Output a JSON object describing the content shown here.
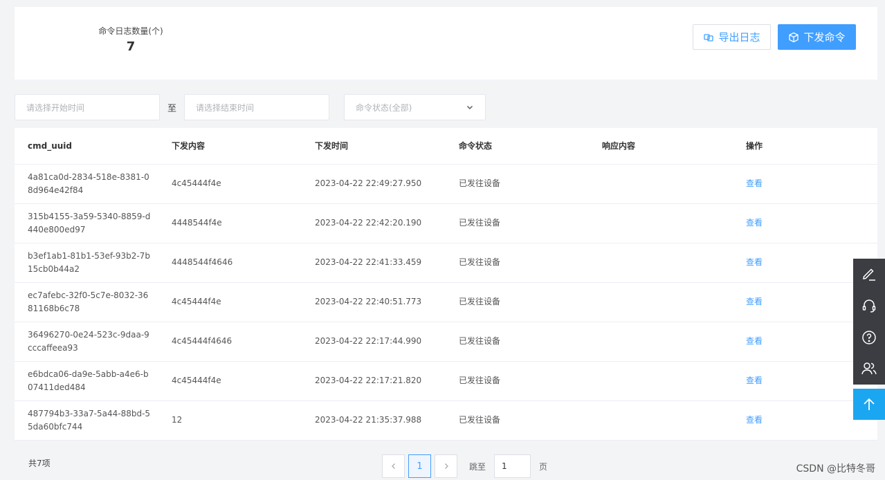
{
  "summary": {
    "label": "命令日志数量(个)",
    "value": "7"
  },
  "toolbar": {
    "export_label": "导出日志",
    "send_label": "下发命令"
  },
  "filters": {
    "start_placeholder": "请选择开始时间",
    "separator": "至",
    "end_placeholder": "请选择结束时间",
    "status_placeholder": "命令状态(全部)"
  },
  "table": {
    "columns": [
      "cmd_uuid",
      "下发内容",
      "下发时间",
      "命令状态",
      "响应内容",
      "操作"
    ],
    "rows": [
      {
        "uuid": "4a81ca0d-2834-518e-8381-08d964e42f84",
        "content": "4c45444f4e",
        "time": "2023-04-22 22:49:27.950",
        "status": "已发往设备",
        "response": "",
        "action": "查看"
      },
      {
        "uuid": "315b4155-3a59-5340-8859-d440e800ed97",
        "content": "4448544f4e",
        "time": "2023-04-22 22:42:20.190",
        "status": "已发往设备",
        "response": "",
        "action": "查看"
      },
      {
        "uuid": "b3ef1ab1-81b1-53ef-93b2-7b15cb0b44a2",
        "content": "4448544f4646",
        "time": "2023-04-22 22:41:33.459",
        "status": "已发往设备",
        "response": "",
        "action": "查看"
      },
      {
        "uuid": "ec7afebc-32f0-5c7e-8032-3681168b6c78",
        "content": "4c45444f4e",
        "time": "2023-04-22 22:40:51.773",
        "status": "已发往设备",
        "response": "",
        "action": "查看"
      },
      {
        "uuid": "36496270-0e24-523c-9daa-9cccaffeea93",
        "content": "4c45444f4646",
        "time": "2023-04-22 22:17:44.990",
        "status": "已发往设备",
        "response": "",
        "action": "查看"
      },
      {
        "uuid": "e6bdca06-da9e-5abb-a4e6-b07411ded484",
        "content": "4c45444f4e",
        "time": "2023-04-22 22:17:21.820",
        "status": "已发往设备",
        "response": "",
        "action": "查看"
      },
      {
        "uuid": "487794b3-33a7-5a44-88bd-55da60bfc744",
        "content": "12",
        "time": "2023-04-22 21:35:37.988",
        "status": "已发往设备",
        "response": "",
        "action": "查看"
      }
    ]
  },
  "pagination": {
    "total_label": "共7项",
    "current_page": "1",
    "jump_prefix": "跳至",
    "jump_value": "1",
    "jump_suffix": "页"
  },
  "side_tools": [
    "edit-icon",
    "headset-icon",
    "help-icon",
    "users-icon"
  ],
  "back_top_icon": "arrow-up-icon",
  "watermark": "CSDN @比特冬哥",
  "colors": {
    "primary": "#409eff",
    "side_bg": "#3b3d42",
    "back_top": "#1aa6f0"
  }
}
